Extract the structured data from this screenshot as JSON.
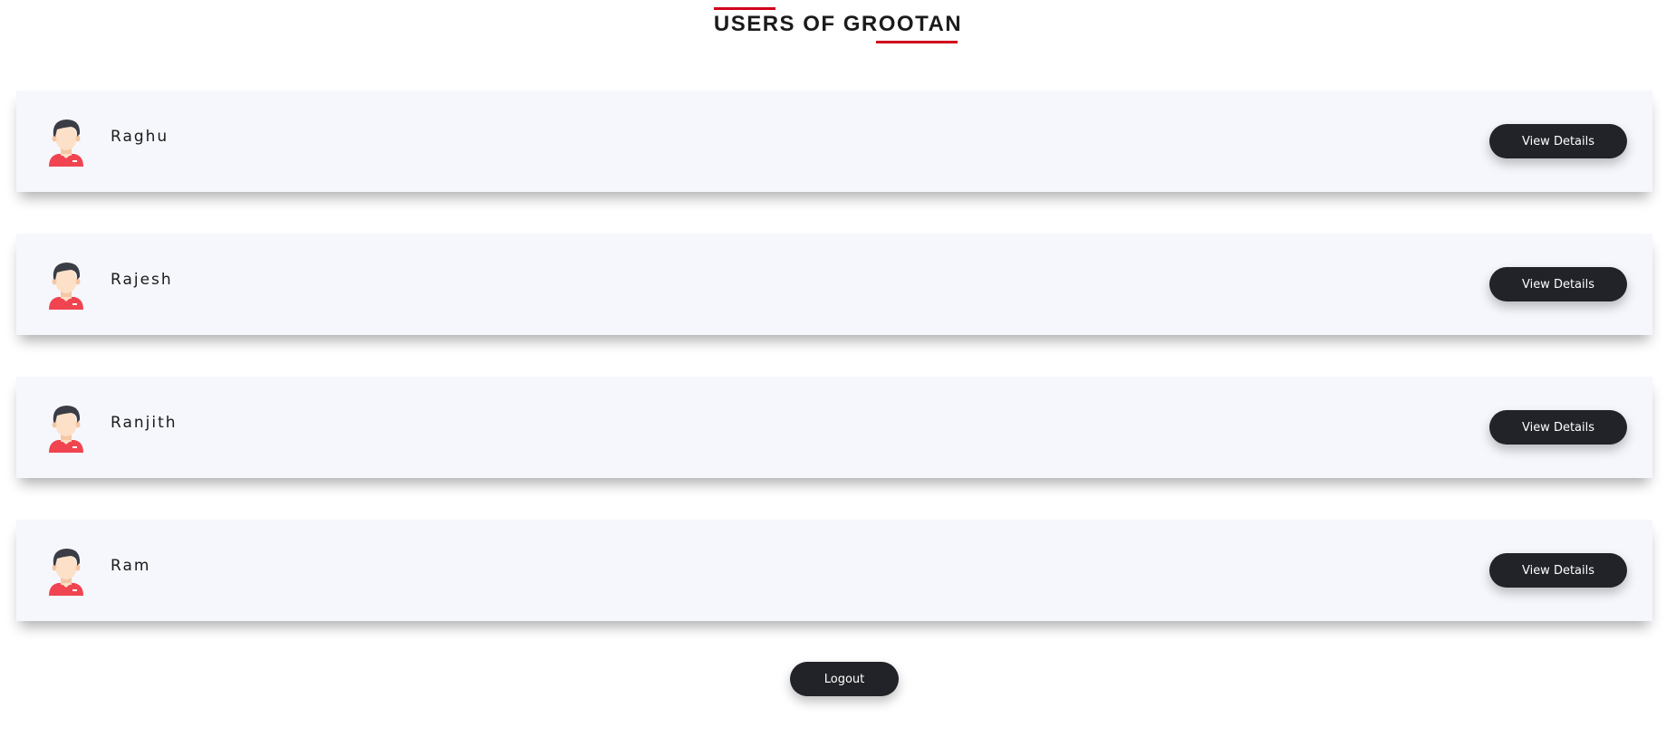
{
  "header": {
    "title": "USERS OF GROOTAN"
  },
  "users": [
    {
      "name": "Raghu",
      "action_label": "View Details"
    },
    {
      "name": "Rajesh",
      "action_label": "View Details"
    },
    {
      "name": "Ranjith",
      "action_label": "View Details"
    },
    {
      "name": "Ram",
      "action_label": "View Details"
    }
  ],
  "footer": {
    "logout_label": "Logout"
  },
  "colors": {
    "accent": "#d0021b",
    "button_bg": "#212328",
    "card_bg": "#f6f7fc",
    "avatar_shirt": "#f04450",
    "avatar_hair": "#3a3d46",
    "avatar_skin": "#fde0c8"
  },
  "icons": {
    "avatar": "user-avatar-icon"
  }
}
